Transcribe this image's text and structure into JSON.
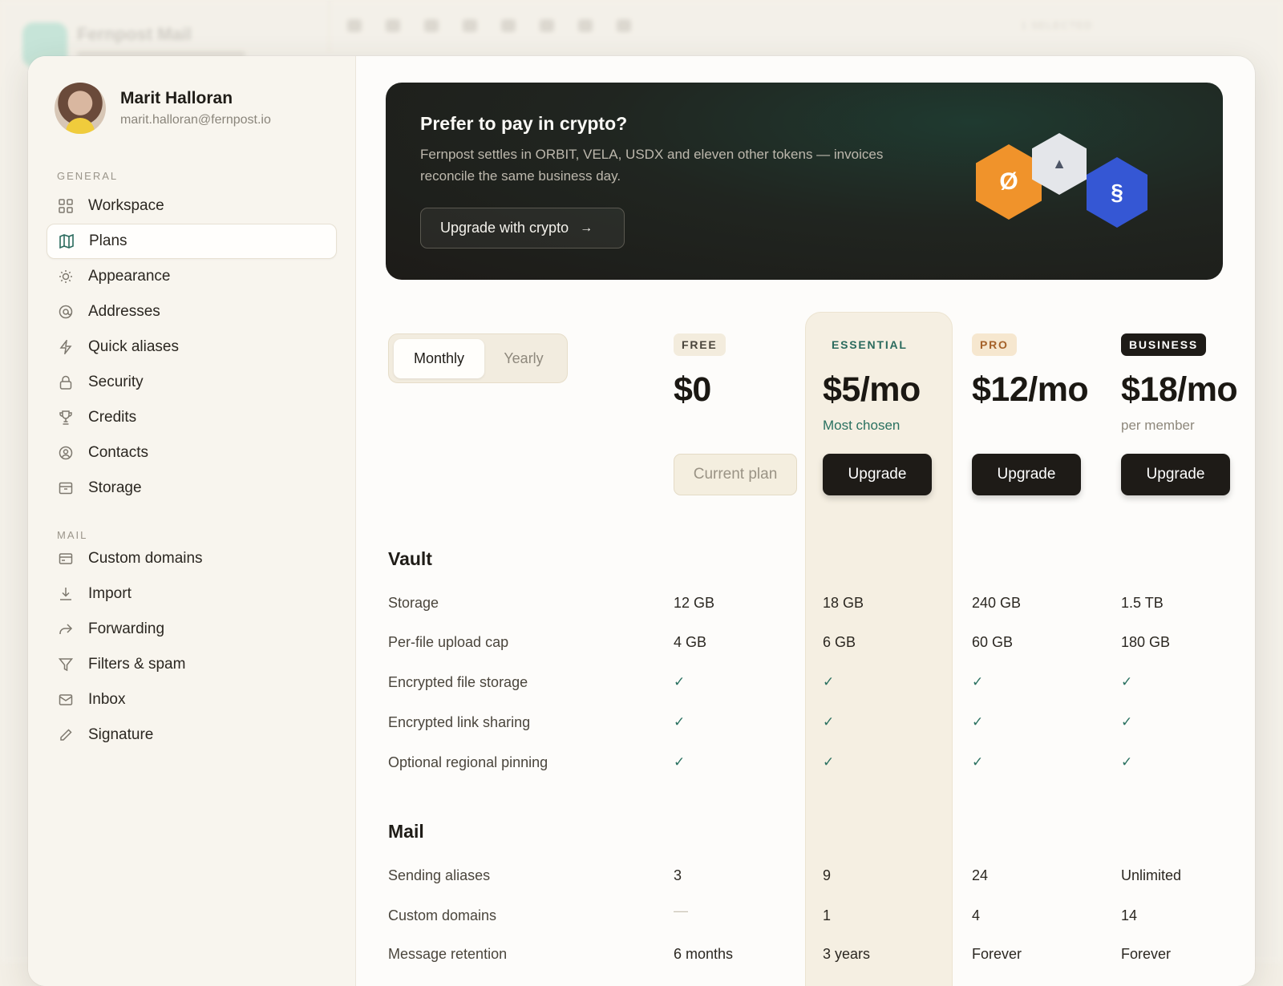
{
  "background_app": {
    "title": "Fernpost Mail",
    "toolbar_text": "1 SELECTED"
  },
  "profile": {
    "name": "Marit Halloran",
    "email": "marit.halloran@fernpost.io"
  },
  "sidebar": {
    "general_label": "GENERAL",
    "general_items": [
      {
        "label": "Workspace",
        "icon": "grid-icon"
      },
      {
        "label": "Plans",
        "icon": "map-icon",
        "active": true
      },
      {
        "label": "Appearance",
        "icon": "sun-icon"
      },
      {
        "label": "Addresses",
        "icon": "at-icon"
      },
      {
        "label": "Quick aliases",
        "icon": "bolt-icon"
      },
      {
        "label": "Security",
        "icon": "lock-icon"
      },
      {
        "label": "Credits",
        "icon": "trophy-icon"
      },
      {
        "label": "Contacts",
        "icon": "user-circle-icon"
      },
      {
        "label": "Storage",
        "icon": "archive-icon"
      }
    ],
    "mail_label": "MAIL",
    "mail_items": [
      {
        "label": "Custom domains",
        "icon": "card-icon"
      },
      {
        "label": "Import",
        "icon": "download-icon"
      },
      {
        "label": "Forwarding",
        "icon": "forward-icon"
      },
      {
        "label": "Filters & spam",
        "icon": "filter-icon"
      },
      {
        "label": "Inbox",
        "icon": "inbox-icon"
      },
      {
        "label": "Signature",
        "icon": "pen-icon"
      }
    ]
  },
  "crypto_banner": {
    "title": "Prefer to pay in crypto?",
    "description": "Fernpost settles in ORBIT, VELA, USDX and eleven other tokens — invoices reconcile the same business day.",
    "button_label": "Upgrade with crypto",
    "tokens": [
      {
        "symbol": "Ø",
        "color": "#f0932b"
      },
      {
        "symbol": "▲",
        "color": "#e4e6ea"
      },
      {
        "symbol": "§",
        "color": "#3557d4"
      }
    ]
  },
  "billing_toggle": {
    "monthly": "Monthly",
    "yearly": "Yearly",
    "selected": "Monthly"
  },
  "plans": [
    {
      "badge": "FREE",
      "price": "$0",
      "note": "",
      "button": "Current plan",
      "button_type": "current"
    },
    {
      "badge": "ESSENTIAL",
      "price": "$5/mo",
      "note": "Most chosen",
      "button": "Upgrade",
      "button_type": "upgrade"
    },
    {
      "badge": "PRO",
      "price": "$12/mo",
      "note": "",
      "button": "Upgrade",
      "button_type": "upgrade"
    },
    {
      "badge": "BUSINESS",
      "price": "$18/mo",
      "note": "per member",
      "button": "Upgrade",
      "button_type": "upgrade"
    }
  ],
  "sections": [
    {
      "title": "Vault",
      "rows": [
        {
          "label": "Storage",
          "values": [
            "12 GB",
            "18 GB",
            "240 GB",
            "1.5 TB"
          ]
        },
        {
          "label": "Per-file upload cap",
          "values": [
            "4 GB",
            "6 GB",
            "60 GB",
            "180 GB"
          ]
        },
        {
          "label": "Encrypted file storage",
          "values": [
            "✓",
            "✓",
            "✓",
            "✓"
          ]
        },
        {
          "label": "Encrypted link sharing",
          "values": [
            "✓",
            "✓",
            "✓",
            "✓"
          ]
        },
        {
          "label": "Optional regional pinning",
          "values": [
            "✓",
            "✓",
            "✓",
            "✓"
          ]
        }
      ]
    },
    {
      "title": "Mail",
      "rows": [
        {
          "label": "Sending aliases",
          "values": [
            "3",
            "9",
            "24",
            "Unlimited"
          ]
        },
        {
          "label": "Custom domains",
          "values": [
            "—",
            "1",
            "4",
            "14"
          ]
        },
        {
          "label": "Message retention",
          "values": [
            "6 months",
            "3 years",
            "Forever",
            "Forever"
          ]
        }
      ]
    }
  ],
  "colors": {
    "accent": "#2a7160",
    "free_badge_bg": "#f3ecdd",
    "essential_badge_text": "#2a6a5d",
    "pro_badge_bg": "#f6e7cf",
    "pro_badge_text": "#a5622a",
    "business_badge_bg": "#1e1b17"
  }
}
